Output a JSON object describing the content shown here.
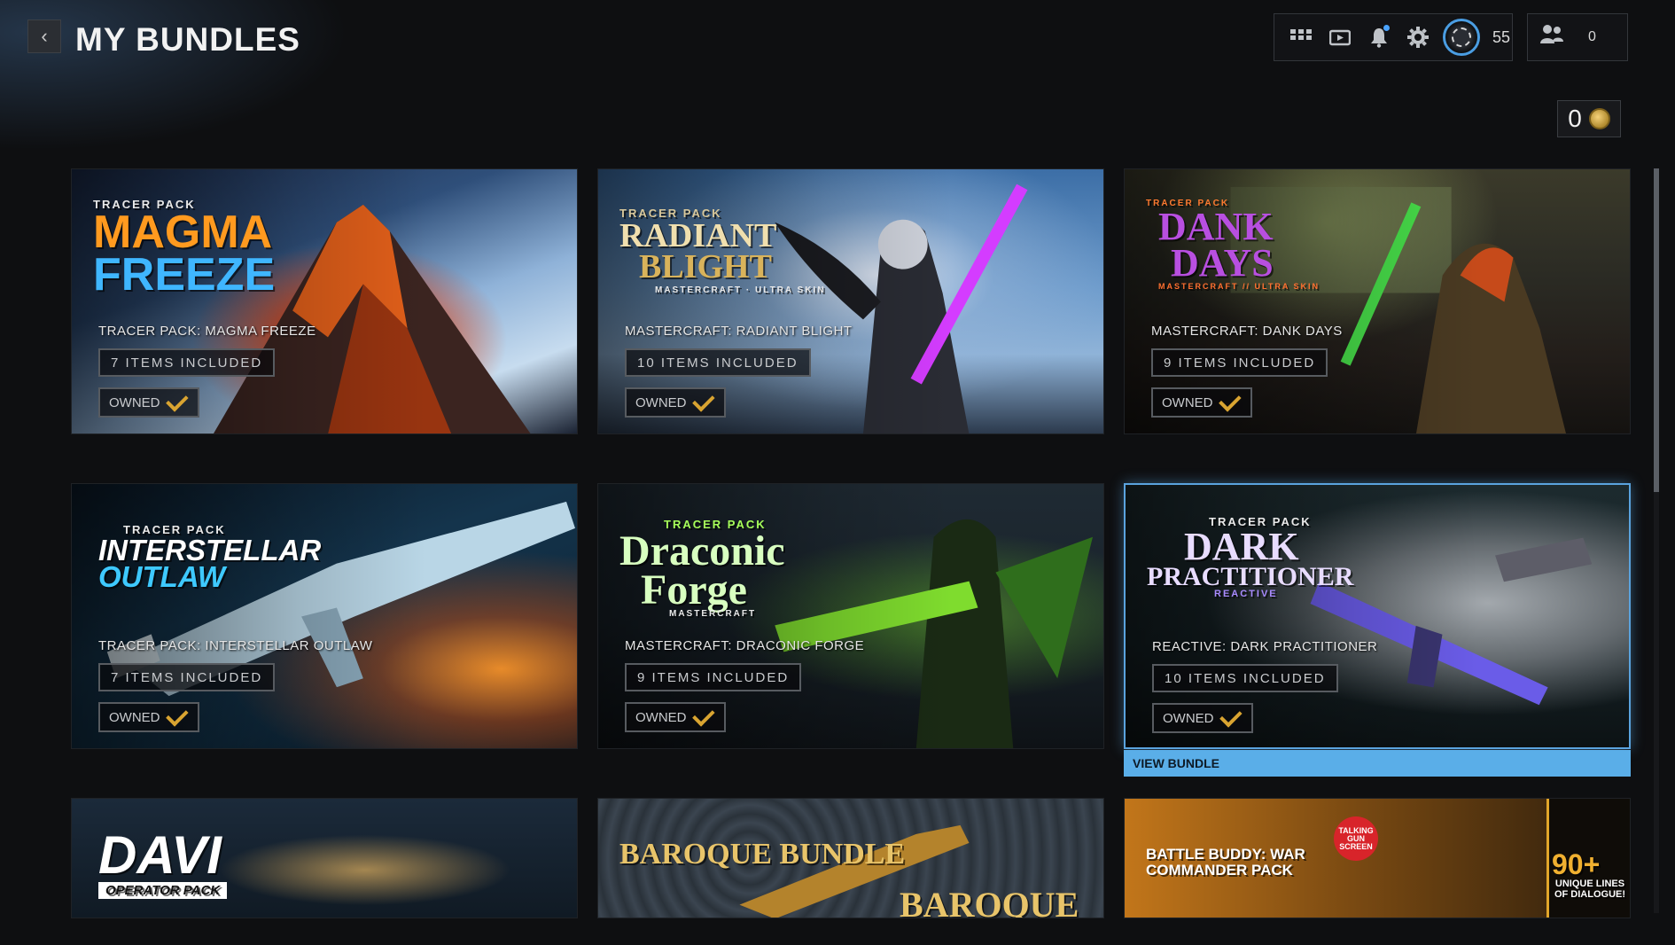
{
  "header": {
    "title": "MY BUNDLES",
    "back_icon": "chevron-left-icon",
    "hud_icons": [
      "grid-icon",
      "video-icon",
      "bell-icon",
      "gear-icon"
    ],
    "level": "55",
    "party_count": "0",
    "currency_amount": "0"
  },
  "bundles": [
    {
      "logo_small": "TRACER PACK",
      "logo_line1": "MAGMA",
      "logo_line2": "FREEZE",
      "name": "TRACER PACK: MAGMA FREEZE",
      "items": "7 ITEMS INCLUDED",
      "status": "OWNED"
    },
    {
      "logo_small": "TRACER PACK",
      "logo_line1": "RADIANT",
      "logo_line2": "BLIGHT",
      "logo_sub": "MASTERCRAFT · ULTRA SKIN",
      "name": "MASTERCRAFT: RADIANT BLIGHT",
      "items": "10 ITEMS INCLUDED",
      "status": "OWNED"
    },
    {
      "logo_small": "TRACER PACK",
      "logo_line1": "DANK",
      "logo_line2": "DAYS",
      "logo_sub": "MASTERCRAFT // ULTRA SKIN",
      "name": "MASTERCRAFT: DANK DAYS",
      "items": "9 ITEMS INCLUDED",
      "status": "OWNED"
    },
    {
      "logo_small": "TRACER PACK",
      "logo_line1": "INTERSTELLAR",
      "logo_line2": "OUTLAW",
      "name": "TRACER PACK: INTERSTELLAR OUTLAW",
      "items": "7 ITEMS INCLUDED",
      "status": "OWNED"
    },
    {
      "logo_small": "TRACER PACK",
      "logo_line1": "Draconic",
      "logo_line2": "Forge",
      "logo_sub": "MASTERCRAFT",
      "name": "MASTERCRAFT: DRACONIC FORGE",
      "items": "9 ITEMS INCLUDED",
      "status": "OWNED"
    },
    {
      "logo_small": "TRACER PACK",
      "logo_line1": "DARK",
      "logo_line2": "PRACTITIONER",
      "logo_sub": "REACTIVE",
      "name": "REACTIVE: DARK PRACTITIONER",
      "items": "10 ITEMS INCLUDED",
      "status": "OWNED"
    }
  ],
  "view_bundle_label": "VIEW BUNDLE",
  "partial_bundles": [
    {
      "logo": "DAVI",
      "sub": "OPERATOR PACK"
    },
    {
      "logo": "BAROQUE BUNDLE",
      "sub": "BAROQUE"
    },
    {
      "logo": "BATTLE BUDDY: WAR COMMANDER PACK",
      "badge": "TALKING GUN SCREEN",
      "sub": "90+",
      "sub2": "UNIQUE LINES OF DIALOGUE!"
    }
  ],
  "colors": {
    "accent": "#5aaee8",
    "owned_check": "#d9a431",
    "background": "#0e0f11"
  }
}
